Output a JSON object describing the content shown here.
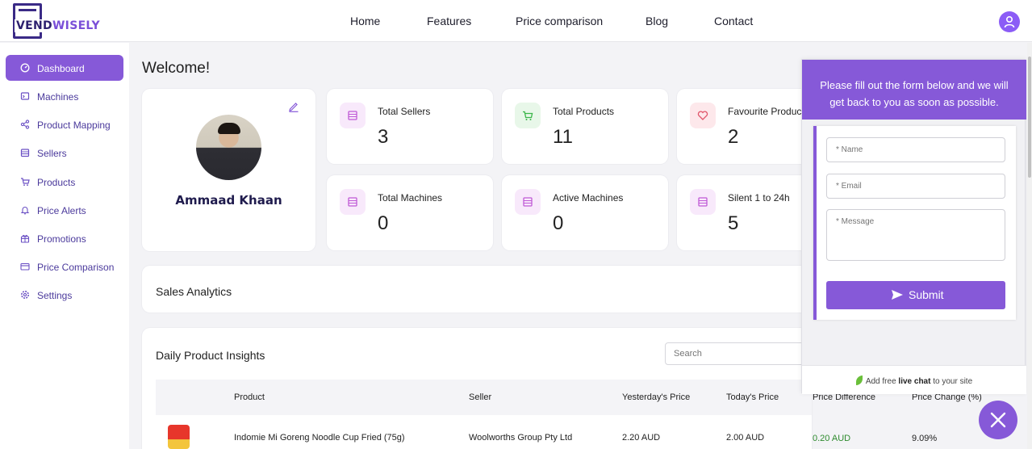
{
  "brand": {
    "name_part1": "VEND",
    "name_part2": "WISELY"
  },
  "nav": {
    "items": [
      "Home",
      "Features",
      "Price comparison",
      "Blog",
      "Contact"
    ]
  },
  "sidebar": {
    "items": [
      {
        "label": "Dashboard",
        "icon": "dashboard-icon",
        "active": true
      },
      {
        "label": "Machines",
        "icon": "machine-icon"
      },
      {
        "label": "Product Mapping",
        "icon": "share-icon"
      },
      {
        "label": "Sellers",
        "icon": "store-icon"
      },
      {
        "label": "Products",
        "icon": "cart-icon"
      },
      {
        "label": "Price Alerts",
        "icon": "bell-icon"
      },
      {
        "label": "Promotions",
        "icon": "gift-icon"
      },
      {
        "label": "Price Comparison",
        "icon": "card-icon"
      },
      {
        "label": "Settings",
        "icon": "gear-icon"
      }
    ]
  },
  "main": {
    "welcome": "Welcome!",
    "profile": {
      "name": "Ammaad Khaan"
    },
    "stats": [
      {
        "title": "Total Sellers",
        "value": "3",
        "icon": "store-icon",
        "color": "#c05ad6"
      },
      {
        "title": "Total Products",
        "value": "11",
        "icon": "cart-icon",
        "color": "#3bb64a"
      },
      {
        "title": "Favourite Products",
        "value": "2",
        "icon": "heart-icon",
        "color": "#e0556a"
      },
      {
        "title": "Total Machines",
        "value": "0",
        "icon": "store-icon",
        "color": "#c05ad6"
      },
      {
        "title": "Active Machines",
        "value": "0",
        "icon": "store-icon",
        "color": "#c05ad6"
      },
      {
        "title": "Silent 1 to 24h",
        "value": "5",
        "icon": "store-icon",
        "color": "#c05ad6"
      }
    ],
    "sales_analytics": "Sales Analytics",
    "insights": {
      "title": "Daily Product Insights",
      "search_placeholder": "Search",
      "columns": [
        "Product",
        "Seller",
        "Yesterday's Price",
        "Today's Price",
        "Price Difference",
        "Price Change (%)"
      ],
      "rows": [
        {
          "product": "Indomie Mi Goreng Noodle Cup Fried (75g)",
          "seller": "Woolworths Group Pty Ltd",
          "yesterday": "2.20 AUD",
          "today": "2.00 AUD",
          "difference": "0.20 AUD",
          "change": "9.09%"
        }
      ]
    }
  },
  "chat": {
    "header": "Please fill out the form below and we will get back to you as soon as possible.",
    "name_placeholder": "* Name",
    "email_placeholder": "* Email",
    "message_placeholder": "* Message",
    "submit_label": "Submit",
    "footer_pre": "Add free ",
    "footer_bold": "live chat",
    "footer_post": " to your site"
  },
  "colors": {
    "accent": "#8659d8",
    "positive": "#2e8b2e"
  }
}
